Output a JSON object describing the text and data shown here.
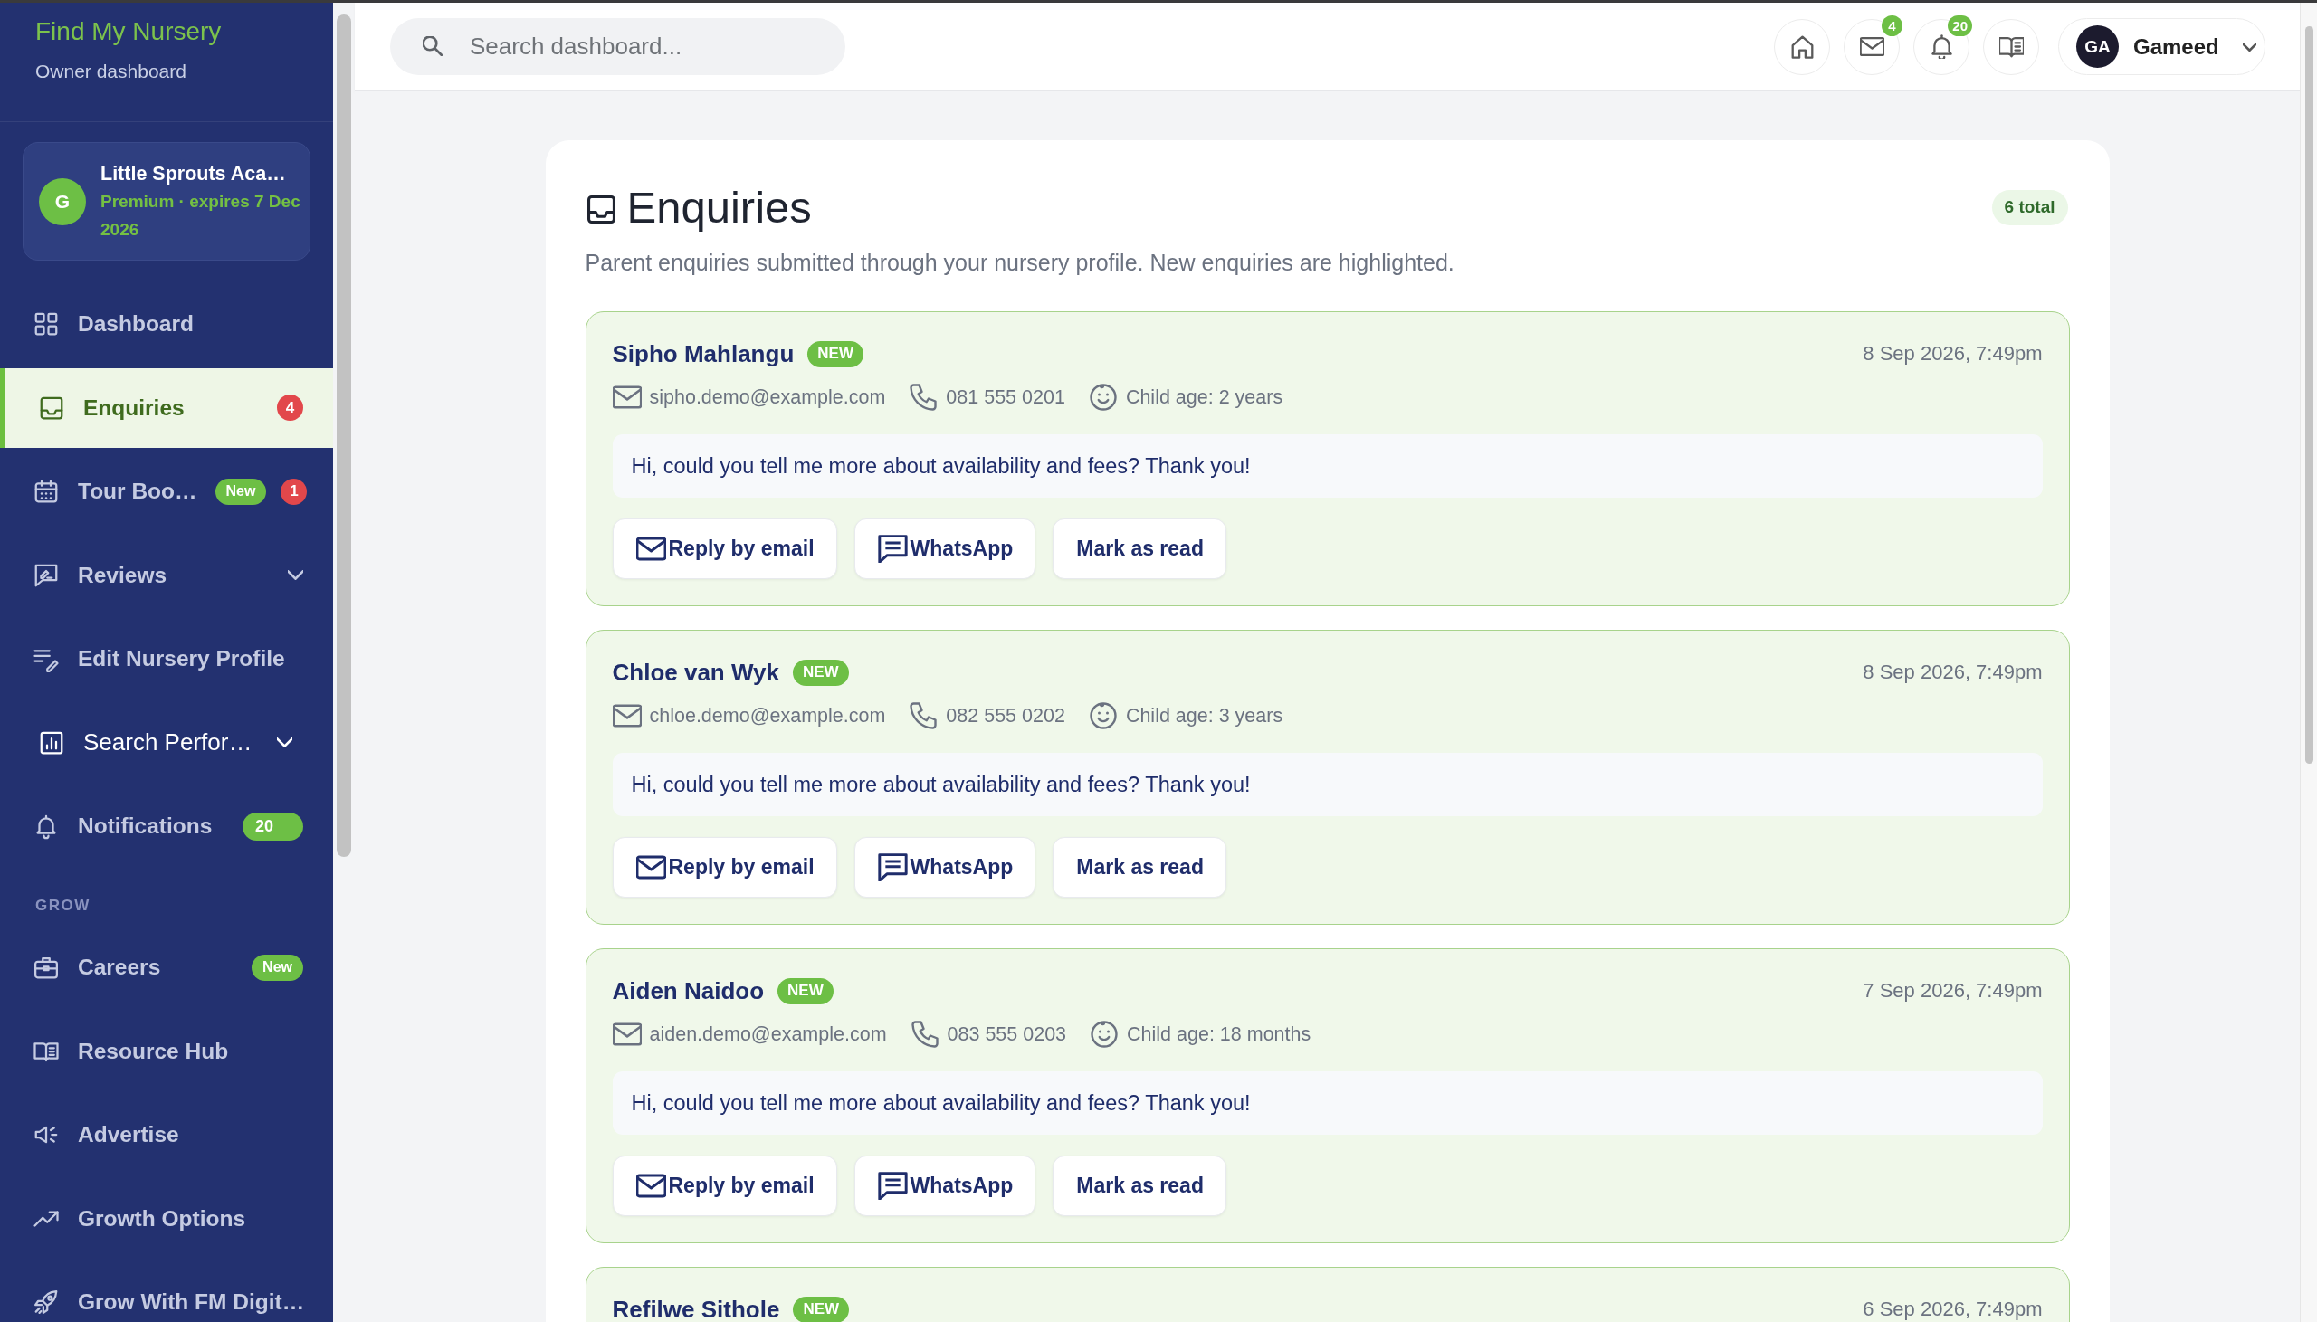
{
  "sidebar": {
    "brand": "Find My Nursery",
    "subtitle": "Owner dashboard",
    "nursery": {
      "avatar": "G",
      "name": "Little Sprouts Aca…",
      "plan": "Premium · expires 7 Dec 2026"
    },
    "sections": [
      {
        "items": [
          {
            "label": "Dashboard",
            "kind": "link",
            "selected": false,
            "hovered": false
          },
          {
            "label": "Enquiries",
            "kind": "link",
            "selected": true,
            "hovered": false,
            "badges": [
              {
                "text": "4",
                "kind": "count",
                "color": "#e2474b"
              }
            ]
          },
          {
            "label": "Tour Boo…",
            "kind": "link",
            "selected": false,
            "hovered": false,
            "badges": [
              {
                "text": "New",
                "kind": "tag",
                "color": "#6dbf45"
              },
              {
                "text": "1",
                "kind": "count",
                "color": "#e2474b"
              }
            ]
          },
          {
            "label": "Reviews",
            "kind": "group",
            "selected": false,
            "hovered": false
          },
          {
            "label": "Edit Nursery Profile",
            "kind": "link",
            "selected": false,
            "hovered": false
          },
          {
            "label": "Search Perfor…",
            "kind": "group",
            "selected": false,
            "hovered": true
          },
          {
            "label": "Notifications",
            "kind": "link",
            "selected": false,
            "hovered": false,
            "badges": [
              {
                "text": "20",
                "kind": "wide",
                "color": "#6dbf45"
              }
            ]
          }
        ]
      },
      {
        "label": "GROW",
        "items": [
          {
            "label": "Careers",
            "kind": "link",
            "selected": false,
            "hovered": false,
            "badges": [
              {
                "text": "New",
                "kind": "tag",
                "color": "#6dbf45"
              }
            ]
          },
          {
            "label": "Resource Hub",
            "kind": "link",
            "selected": false,
            "hovered": false
          },
          {
            "label": "Advertise",
            "kind": "link",
            "selected": false,
            "hovered": false
          },
          {
            "label": "Growth Options",
            "kind": "link",
            "selected": false,
            "hovered": false
          },
          {
            "label": "Grow With FM Digit…",
            "kind": "link",
            "selected": false,
            "hovered": false
          }
        ]
      }
    ]
  },
  "topbar": {
    "search": {
      "placeholder": "Search dashboard..."
    },
    "mail_badge": "4",
    "notification_badge": "20",
    "user": {
      "initials": "GA",
      "name": "Gameed"
    }
  },
  "page": {
    "title": "Enquiries",
    "total": "6 total",
    "description": "Parent enquiries submitted through your nursery profile. New enquiries are highlighted.",
    "enquiries": [
      {
        "name": "Sipho Mahlangu",
        "badge": "NEW",
        "highlighted": true,
        "date": "8 Sep 2026, 7:49pm",
        "email": "sipho.demo@example.com",
        "phone": "081 555 0201",
        "child_age": "Child age: 2 years",
        "message": "Hi, could you tell me more about availability and fees? Thank you!",
        "actions": [
          "Reply by email",
          "WhatsApp",
          "Mark as read"
        ]
      },
      {
        "name": "Chloe van Wyk",
        "badge": "NEW",
        "highlighted": true,
        "date": "8 Sep 2026, 7:49pm",
        "email": "chloe.demo@example.com",
        "phone": "082 555 0202",
        "child_age": "Child age: 3 years",
        "message": "Hi, could you tell me more about availability and fees? Thank you!",
        "actions": [
          "Reply by email",
          "WhatsApp",
          "Mark as read"
        ]
      },
      {
        "name": "Aiden Naidoo",
        "badge": "NEW",
        "highlighted": true,
        "date": "7 Sep 2026, 7:49pm",
        "email": "aiden.demo@example.com",
        "phone": "083 555 0203",
        "child_age": "Child age: 18 months",
        "message": "Hi, could you tell me more about availability and fees? Thank you!",
        "actions": [
          "Reply by email",
          "WhatsApp",
          "Mark as read"
        ]
      },
      {
        "name": "Refilwe Sithole",
        "badge": "NEW",
        "highlighted": true,
        "date": "6 Sep 2026, 7:49pm"
      }
    ]
  }
}
